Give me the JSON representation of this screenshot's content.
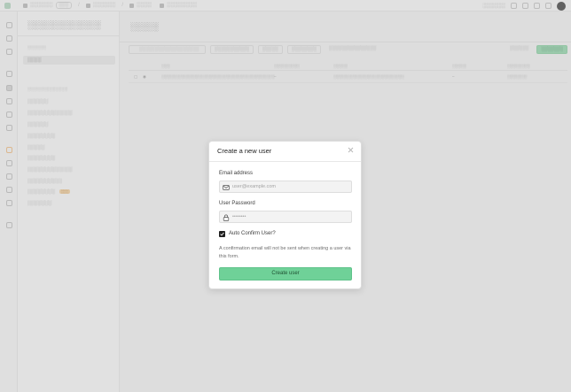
{
  "modal": {
    "title": "Create a new user",
    "email_label": "Email address",
    "email_placeholder": "user@example.com",
    "password_label": "User Password",
    "password_placeholder": "••••••••",
    "auto_confirm_label": "Auto Confirm User?",
    "auto_confirm_checked": true,
    "note": "A confirmation email will not be sent when creating a user via this form.",
    "submit_label": "Create user"
  }
}
